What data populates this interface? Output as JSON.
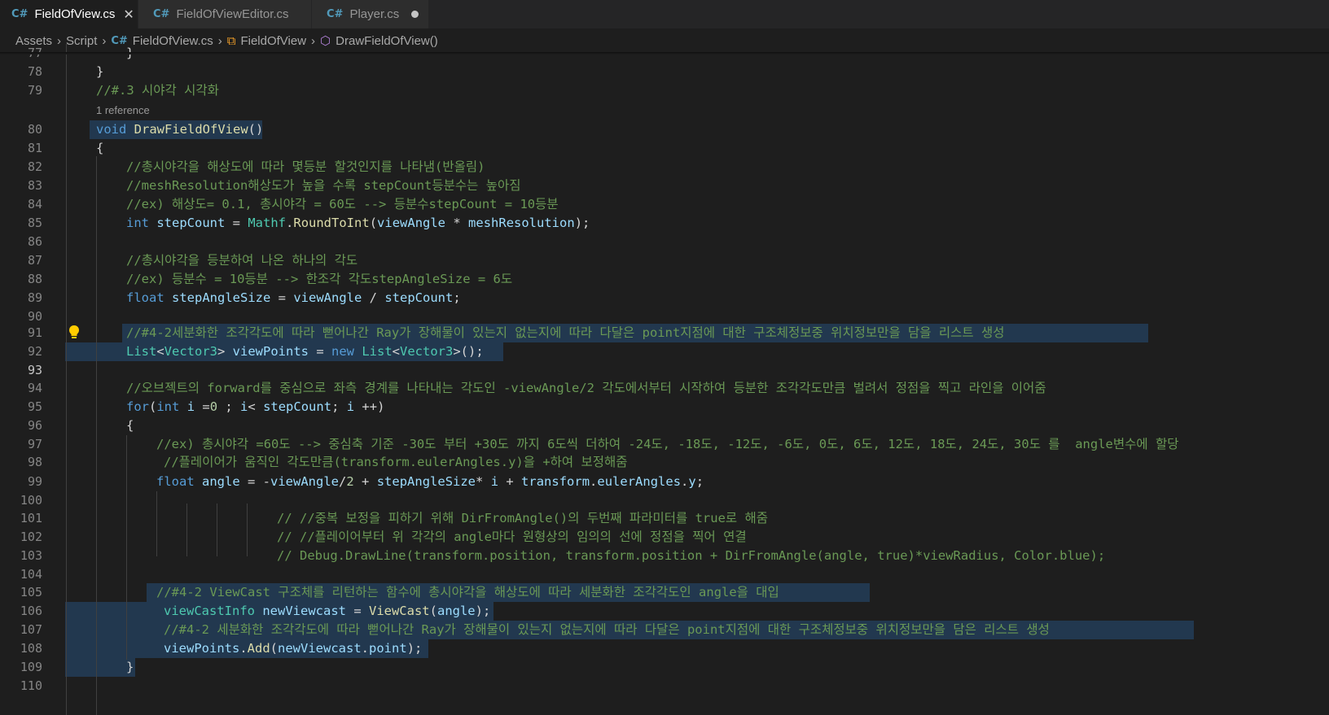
{
  "tabs": [
    {
      "label": "FieldOfView.cs",
      "icon": "csharp-icon",
      "active": true,
      "state": "close"
    },
    {
      "label": "FieldOfViewEditor.cs",
      "icon": "csharp-icon",
      "active": false,
      "state": ""
    },
    {
      "label": "Player.cs",
      "icon": "csharp-icon",
      "active": false,
      "state": "dirty"
    }
  ],
  "breadcrumb": {
    "assets": "Assets",
    "script": "Script",
    "file": "FieldOfView.cs",
    "class": "FieldOfView",
    "method": "DrawFieldOfView()"
  },
  "code_lens": "1 reference",
  "lines": {
    "l77": {
      "num": "77",
      "text": "}"
    },
    "l78": {
      "num": "78",
      "text": "}"
    },
    "l79": {
      "num": "79",
      "text": "//#.3 시야각 시각화"
    },
    "l80": {
      "num": "80",
      "a": "void",
      "b": "DrawFieldOfView",
      "c": "()"
    },
    "l81": {
      "num": "81",
      "text": "{"
    },
    "l82": {
      "num": "82",
      "text": "//총시야각을 해상도에 따라 몇등분 할것인지를 나타냄(반올림)"
    },
    "l83": {
      "num": "83",
      "text": "//meshResolution해상도가 높을 수록 stepCount등분수는 높아짐"
    },
    "l84": {
      "num": "84",
      "text": "//ex) 해상도= 0.1, 총시야각 = 60도 --> 등분수stepCount = 10등분"
    },
    "l85": {
      "num": "85",
      "a": "int",
      "b": "stepCount",
      "c": " = ",
      "d": "Mathf",
      "e": ".",
      "f": "RoundToInt",
      "g": "(",
      "h": "viewAngle",
      "i": " * ",
      "j": "meshResolution",
      "k": ");"
    },
    "l86": {
      "num": "86"
    },
    "l87": {
      "num": "87",
      "text": "//총시야각을 등분하여 나온 하나의 각도"
    },
    "l88": {
      "num": "88",
      "text": "//ex) 등분수 = 10등분 --> 한조각 각도stepAngleSize = 6도"
    },
    "l89": {
      "num": "89",
      "a": "float",
      "b": "stepAngleSize",
      "c": " = ",
      "d": "viewAngle",
      "e": " / ",
      "f": "stepCount",
      "g": ";"
    },
    "l90": {
      "num": "90"
    },
    "l91": {
      "num": "91",
      "text": "//#4-2세분화한 조각각도에 따라 뻗어나간 Ray가 장해물이 있는지 없는지에 따라 다달은 point지점에 대한 구조체정보중 위치정보만을 담을 리스트 생성"
    },
    "l92": {
      "num": "92",
      "a": "List",
      "b": "<",
      "c": "Vector3",
      "d": "> ",
      "e": "viewPoints",
      "f": " = ",
      "g": "new",
      "h": " ",
      "i": "List",
      "j": "<",
      "k": "Vector3",
      "l": ">();"
    },
    "l93": {
      "num": "93"
    },
    "l94": {
      "num": "94",
      "text": "//오브젝트의 forward를 중심으로 좌측 경계를 나타내는 각도인 -viewAngle/2 각도에서부터 시작하여 등분한 조각각도만큼 벌려서 정점을 찍고 라인을 이어줌"
    },
    "l95": {
      "num": "95",
      "a": "for",
      "b": "(",
      "c": "int",
      "d": " ",
      "e": "i",
      "f": " =",
      "g": "0",
      "h": " ; ",
      "i": "i",
      "j": "< ",
      "k": "stepCount",
      "l": "; ",
      "m": "i",
      "n": " ++)"
    },
    "l96": {
      "num": "96",
      "text": "{"
    },
    "l97": {
      "num": "97",
      "text": "//ex) 총시야각 =60도 --> 중심축 기준 -30도 부터 +30도 까지 6도씩 더하여 -24도, -18도, -12도, -6도, 0도, 6도, 12도, 18도, 24도, 30도 를  angle변수에 할당"
    },
    "l98": {
      "num": "98",
      "text": "//플레이어가 움직인 각도만큼(transform.eulerAngles.y)을 +하여 보정해줌"
    },
    "l99": {
      "num": "99",
      "a": "float",
      "b": "angle",
      "c": " = -",
      "d": "viewAngle",
      "e": "/",
      "f": "2",
      "g": " + ",
      "h": "stepAngleSize",
      "i": "* ",
      "j": "i",
      "k": " + ",
      "l": "transform",
      "m": ".",
      "n": "eulerAngles",
      "o": ".",
      "p": "y",
      "q": ";"
    },
    "l100": {
      "num": "100"
    },
    "l101": {
      "num": "101",
      "text": "// //중복 보정을 피하기 위해 DirFromAngle()의 두번째 파라미터를 true로 해줌"
    },
    "l102": {
      "num": "102",
      "text": "// //플레이어부터 위 각각의 angle마다 원형상의 임의의 선에 정점을 찍어 연결"
    },
    "l103": {
      "num": "103",
      "text": "// Debug.DrawLine(transform.position, transform.position + DirFromAngle(angle, true)*viewRadius, Color.blue);"
    },
    "l104": {
      "num": "104"
    },
    "l105": {
      "num": "105",
      "text": "//#4-2 ViewCast 구조체를 리턴하는 함수에 총시야각을 해상도에 따라 세분화한 조각각도인 angle을 대입"
    },
    "l106": {
      "num": "106",
      "a": "viewCastInfo",
      "b": " ",
      "c": "newViewcast",
      "d": " = ",
      "e": "ViewCast",
      "f": "(",
      "g": "angle",
      "h": ");"
    },
    "l107": {
      "num": "107",
      "text": "//#4-2 세분화한 조각각도에 따라 뻗어나간 Ray가 장해물이 있는지 없는지에 따라 다달은 point지점에 대한 구조체정보중 위치정보만을 담은 리스트 생성"
    },
    "l108": {
      "num": "108",
      "a": "viewPoints",
      "b": ".",
      "c": "Add",
      "d": "(",
      "e": "newViewcast",
      "f": ".",
      "g": "point",
      "h": ");"
    },
    "l109": {
      "num": "109",
      "text": "}"
    },
    "l110": {
      "num": "110"
    }
  },
  "colors": {
    "background": "#1e1e1e",
    "keyword": "#569cd6",
    "type": "#4ec9b0",
    "function": "#dcdcaa",
    "variable": "#9cdcfe",
    "number": "#b5cea8",
    "comment": "#6a9955",
    "selection": "#264f78"
  }
}
